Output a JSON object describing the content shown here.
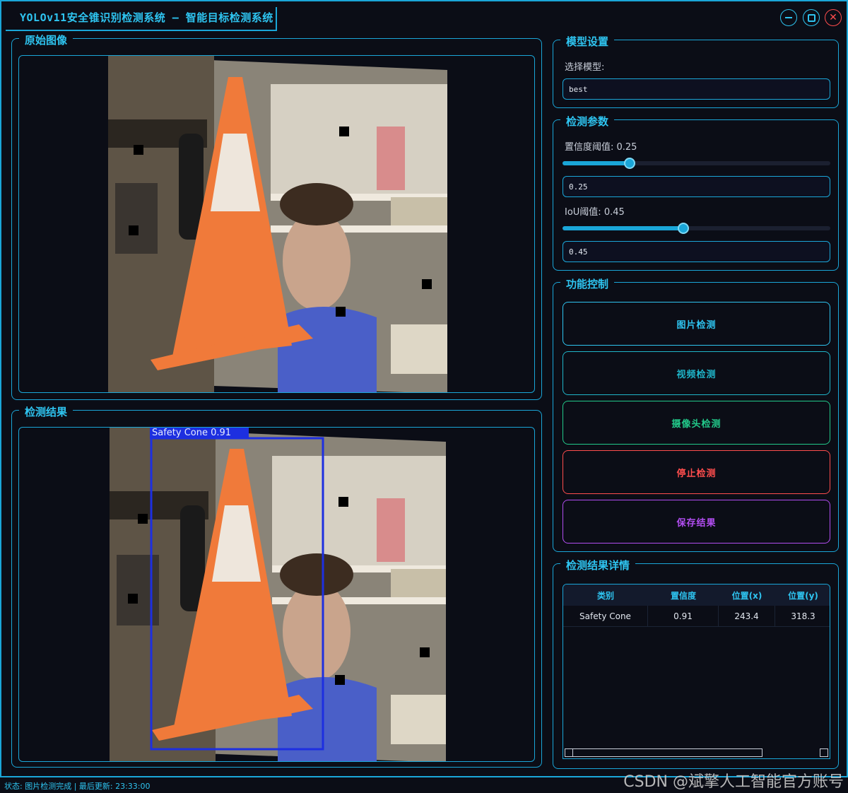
{
  "window": {
    "title": "YOLOv11安全锥识别检测系统 – 智能目标检测系统"
  },
  "original_panel": {
    "title": "原始图像"
  },
  "result_panel": {
    "title": "检测结果",
    "detection_label": "Safety Cone 0.91"
  },
  "model_settings": {
    "title": "模型设置",
    "select_label": "选择模型:",
    "selected_model": "best"
  },
  "params": {
    "title": "检测参数",
    "confidence_label": "置信度阈值: 0.25",
    "confidence_value": "0.25",
    "confidence_fraction": 0.25,
    "iou_label": "IoU阈值: 0.45",
    "iou_value": "0.45",
    "iou_fraction": 0.45
  },
  "controls": {
    "title": "功能控制",
    "image_detect": "图片检测",
    "video_detect": "视频检测",
    "camera_detect": "摄像头检测",
    "stop_detect": "停止检测",
    "save_results": "保存结果"
  },
  "colors": {
    "accent": "#1aa6d8",
    "image_button": "#2ec4f0",
    "video_button": "#1fb5c9",
    "camera_button": "#22c98a",
    "stop_button": "#ff4d4d",
    "save_button": "#b14df0",
    "bbox": "#1d2fe0"
  },
  "results_table": {
    "title": "检测结果详情",
    "columns": [
      "类别",
      "置信度",
      "位置(x)",
      "位置(y)"
    ],
    "rows": [
      [
        "Safety Cone",
        "0.91",
        "243.4",
        "318.3"
      ]
    ]
  },
  "status_bar": {
    "text": "状态: 图片检测完成 | 最后更新: 23:33:00"
  },
  "watermark": "CSDN @斌擎人工智能官方账号"
}
